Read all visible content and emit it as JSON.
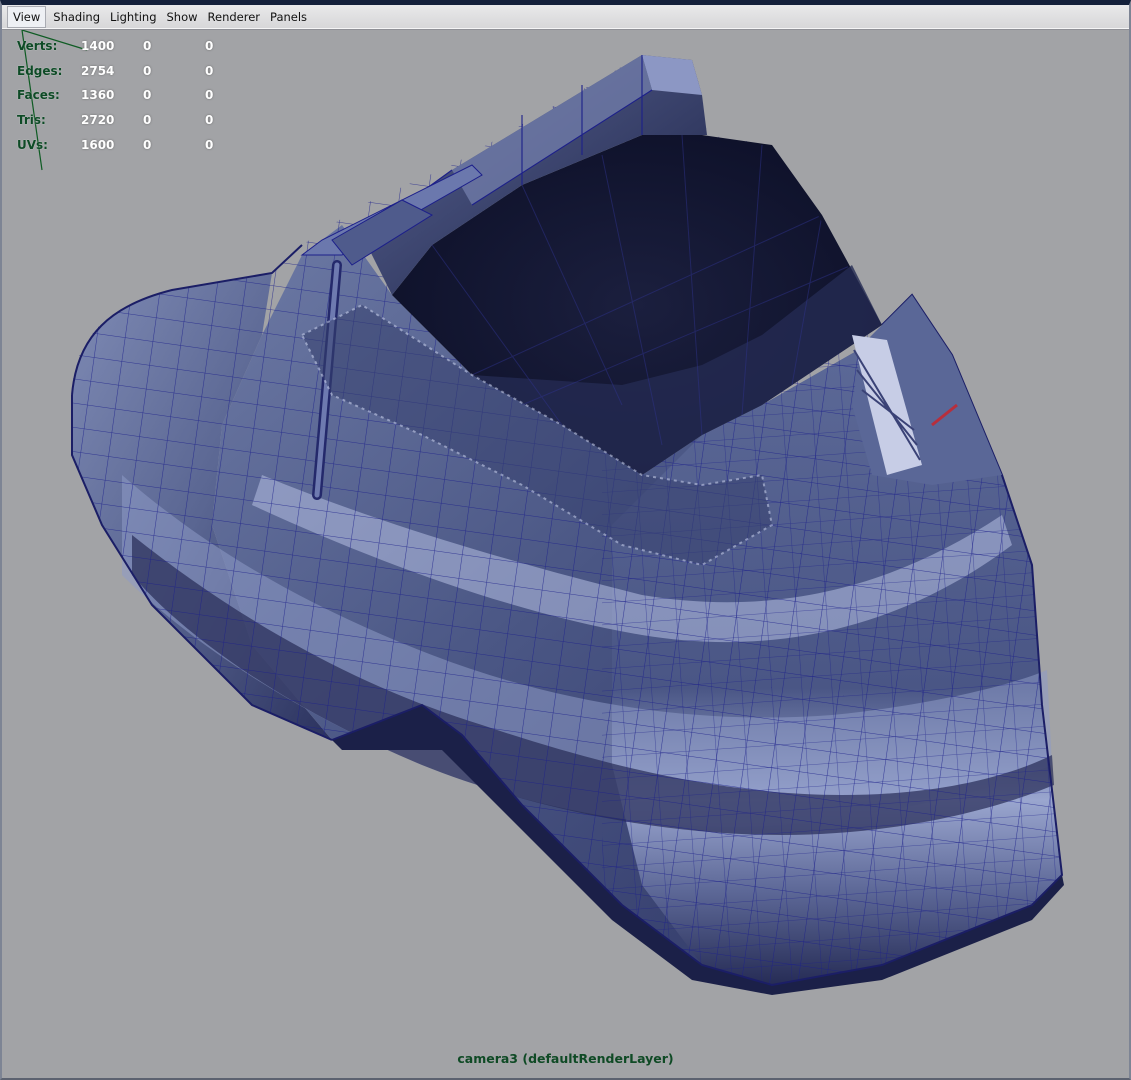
{
  "menubar": {
    "items": [
      "View",
      "Shading",
      "Lighting",
      "Show",
      "Renderer",
      "Panels"
    ]
  },
  "hud": {
    "rows": [
      {
        "label": "Verts:",
        "values": [
          "1400",
          "0",
          "0"
        ]
      },
      {
        "label": "Edges:",
        "values": [
          "2754",
          "0",
          "0"
        ]
      },
      {
        "label": "Faces:",
        "values": [
          "1360",
          "0",
          "0"
        ]
      },
      {
        "label": "Tris:",
        "values": [
          "2720",
          "0",
          "0"
        ]
      },
      {
        "label": "UVs:",
        "values": [
          "1600",
          "0",
          "0"
        ]
      }
    ]
  },
  "viewport": {
    "camera_label": "camera3 (defaultRenderLayer)",
    "background_color": "#a2a3a6",
    "wireframe_color": "#1c1f8a",
    "label_color": "#0f4a25"
  }
}
